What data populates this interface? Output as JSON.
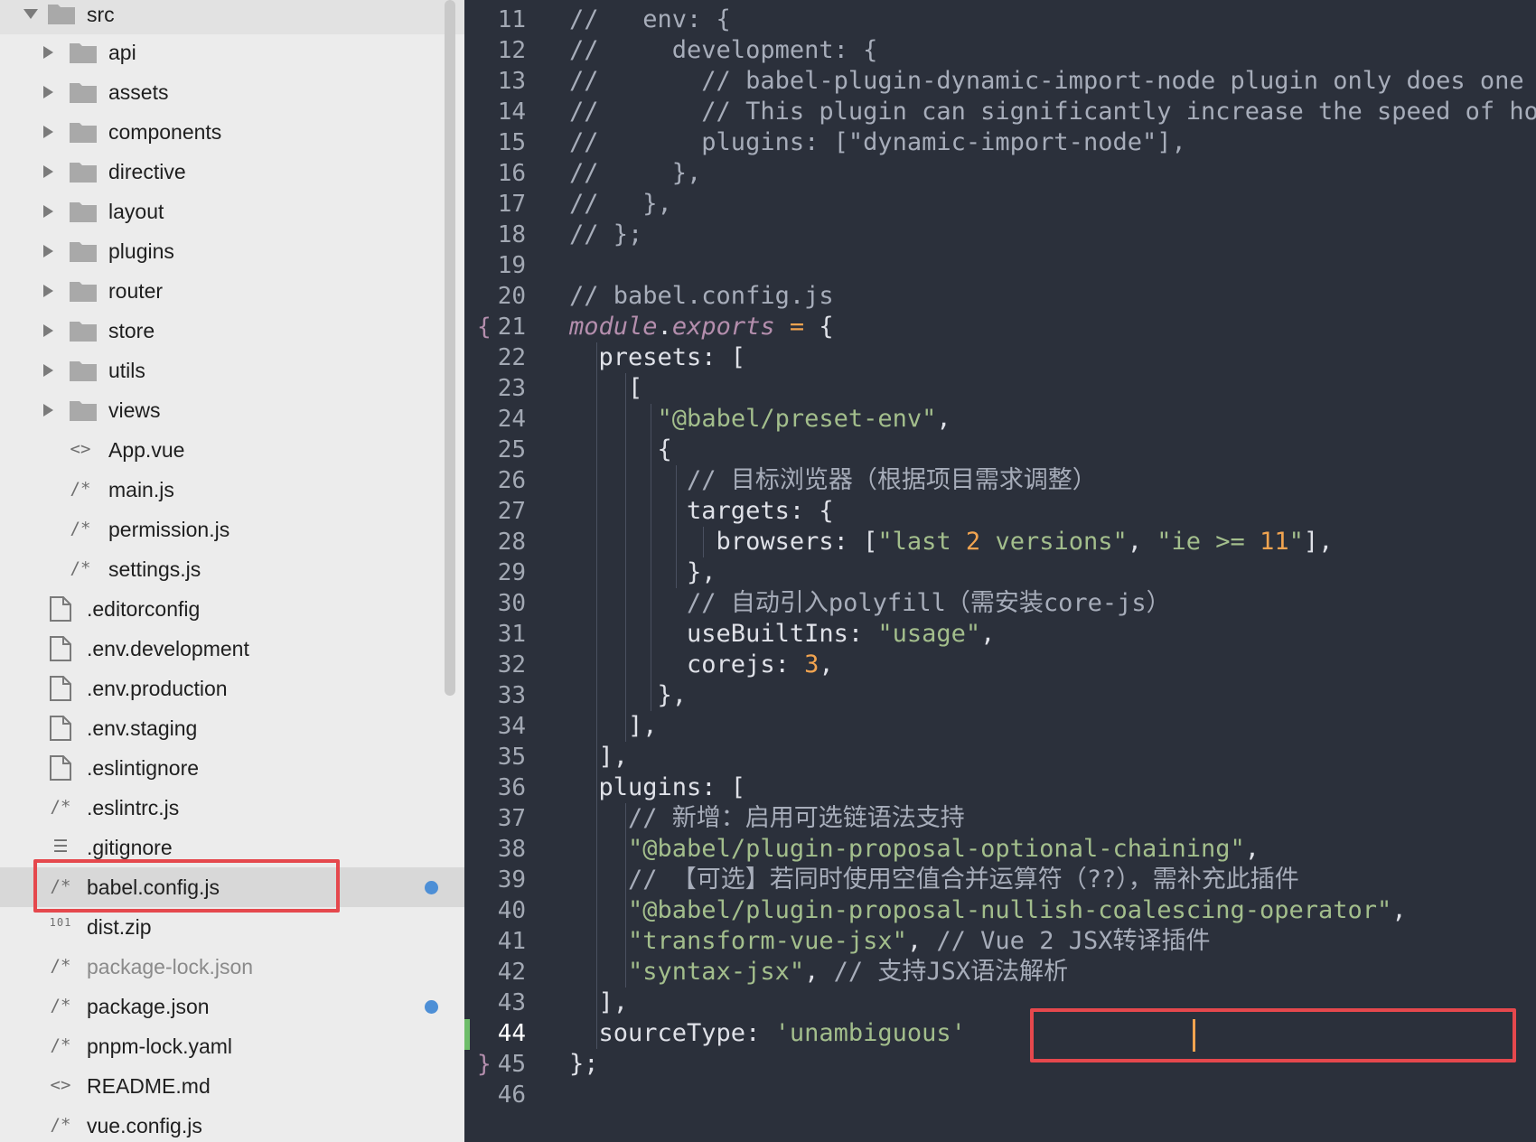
{
  "sidebar": {
    "src_folder": "src",
    "items": [
      {
        "label": "api",
        "kind": "folder"
      },
      {
        "label": "assets",
        "kind": "folder"
      },
      {
        "label": "components",
        "kind": "folder"
      },
      {
        "label": "directive",
        "kind": "folder"
      },
      {
        "label": "layout",
        "kind": "folder"
      },
      {
        "label": "plugins",
        "kind": "folder"
      },
      {
        "label": "router",
        "kind": "folder"
      },
      {
        "label": "store",
        "kind": "folder"
      },
      {
        "label": "utils",
        "kind": "folder"
      },
      {
        "label": "views",
        "kind": "folder"
      },
      {
        "label": "App.vue",
        "kind": "code",
        "glyph": "<>"
      },
      {
        "label": "main.js",
        "kind": "code",
        "glyph": "/*"
      },
      {
        "label": "permission.js",
        "kind": "code",
        "glyph": "/*"
      },
      {
        "label": "settings.js",
        "kind": "code",
        "glyph": "/*"
      }
    ],
    "root_items": [
      {
        "label": ".editorconfig",
        "kind": "file"
      },
      {
        "label": ".env.development",
        "kind": "file"
      },
      {
        "label": ".env.production",
        "kind": "file"
      },
      {
        "label": ".env.staging",
        "kind": "file"
      },
      {
        "label": ".eslintignore",
        "kind": "file"
      },
      {
        "label": ".eslintrc.js",
        "kind": "code",
        "glyph": "/*"
      },
      {
        "label": ".gitignore",
        "kind": "list",
        "glyph": "☰"
      },
      {
        "label": "babel.config.js",
        "kind": "code",
        "glyph": "/*",
        "selected": true,
        "modified": true
      },
      {
        "label": "dist.zip",
        "kind": "binary",
        "glyph": "101"
      },
      {
        "label": "package-lock.json",
        "kind": "code",
        "glyph": "/*",
        "muted": true
      },
      {
        "label": "package.json",
        "kind": "code",
        "glyph": "/*",
        "modified": true
      },
      {
        "label": "pnpm-lock.yaml",
        "kind": "code",
        "glyph": "/*"
      },
      {
        "label": "README.md",
        "kind": "code",
        "glyph": "<>"
      },
      {
        "label": "vue.config.js",
        "kind": "code",
        "glyph": "/*"
      }
    ]
  },
  "editor": {
    "lines": [
      {
        "n": "11",
        "text": "//   env: {"
      },
      {
        "n": "12",
        "text": "//     development: {"
      },
      {
        "n": "13",
        "text": "//       // babel-plugin-dynamic-import-node plugin only does one t"
      },
      {
        "n": "14",
        "text": "//       // This plugin can significantly increase the speed of hot"
      },
      {
        "n": "15",
        "text": "//       plugins: [\"dynamic-import-node\"],"
      },
      {
        "n": "16",
        "text": "//     },"
      },
      {
        "n": "17",
        "text": "//   },"
      },
      {
        "n": "18",
        "text": "// };"
      },
      {
        "n": "19",
        "text": ""
      },
      {
        "n": "20",
        "text": "// babel.config.js"
      },
      {
        "n": "21",
        "text": "module.exports = {",
        "brace": "{"
      },
      {
        "n": "22",
        "text": "  presets: ["
      },
      {
        "n": "23",
        "text": "    ["
      },
      {
        "n": "24",
        "text": "      \"@babel/preset-env\","
      },
      {
        "n": "25",
        "text": "      {"
      },
      {
        "n": "26",
        "text": "        // 目标浏览器（根据项目需求调整）"
      },
      {
        "n": "27",
        "text": "        targets: {"
      },
      {
        "n": "28",
        "text": "          browsers: [\"last 2 versions\", \"ie >= 11\"],"
      },
      {
        "n": "29",
        "text": "        },"
      },
      {
        "n": "30",
        "text": "        // 自动引入polyfill（需安装core-js）"
      },
      {
        "n": "31",
        "text": "        useBuiltIns: \"usage\","
      },
      {
        "n": "32",
        "text": "        corejs: 3,"
      },
      {
        "n": "33",
        "text": "      },"
      },
      {
        "n": "34",
        "text": "    ],"
      },
      {
        "n": "35",
        "text": "  ],"
      },
      {
        "n": "36",
        "text": "  plugins: ["
      },
      {
        "n": "37",
        "text": "    // 新增：启用可选链语法支持"
      },
      {
        "n": "38",
        "text": "    \"@babel/plugin-proposal-optional-chaining\","
      },
      {
        "n": "39",
        "text": "    // 【可选】若同时使用空值合并运算符（??），需补充此插件"
      },
      {
        "n": "40",
        "text": "    \"@babel/plugin-proposal-nullish-coalescing-operator\","
      },
      {
        "n": "41",
        "text": "    \"transform-vue-jsx\", // Vue 2 JSX转译插件"
      },
      {
        "n": "42",
        "text": "    \"syntax-jsx\", // 支持JSX语法解析"
      },
      {
        "n": "43",
        "text": "  ],"
      },
      {
        "n": "44",
        "text": "  sourceType: 'unambiguous'",
        "active": true
      },
      {
        "n": "45",
        "text": "};",
        "brace": "}"
      },
      {
        "n": "46",
        "text": ""
      }
    ]
  },
  "colors": {
    "editor_bg": "#2b303b",
    "sidebar_bg": "#ececec",
    "highlight_box": "#e5484d",
    "modified_dot": "#4d8fd6",
    "string": "#a3be8c",
    "number": "#f2a450",
    "keyword": "#b48ead"
  }
}
